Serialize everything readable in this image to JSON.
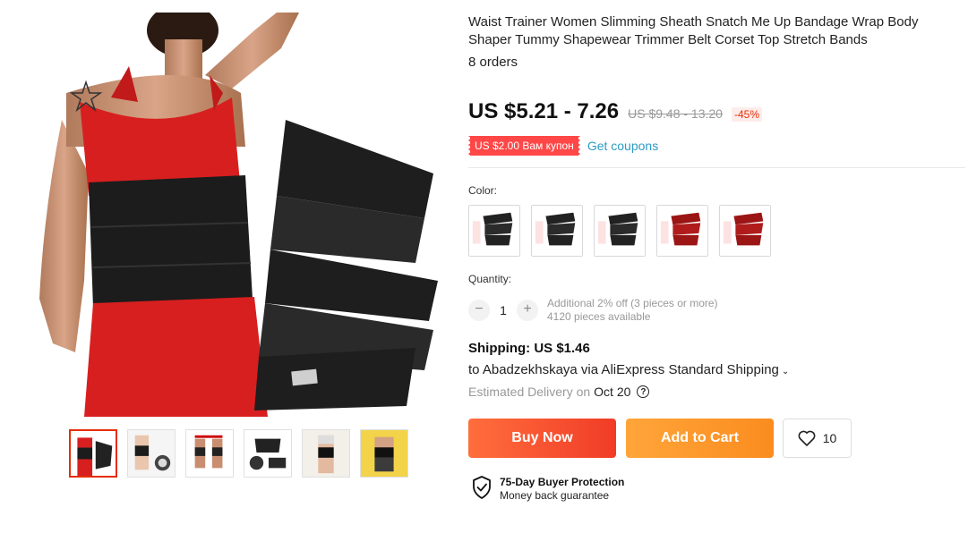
{
  "product": {
    "title": "Waist Trainer Women Slimming Sheath Snatch Me Up Bandage Wrap Body Shaper Tummy Shapewear Trimmer Belt Corset Top Stretch Bands",
    "orders": "8 orders",
    "price": "US $5.21 - 7.26",
    "old_price": "US $9.48 - 13.20",
    "discount": "-45%"
  },
  "coupon": {
    "badge": "US $2.00 Вам купон",
    "link": "Get coupons"
  },
  "colors": {
    "label": "Color:",
    "swatches": [
      "black",
      "black",
      "black",
      "red",
      "red"
    ]
  },
  "quantity": {
    "label": "Quantity:",
    "minus": "−",
    "plus": "+",
    "value": "1",
    "offer": "Additional 2% off (3 pieces or more)",
    "available": "4120 pieces available"
  },
  "shipping": {
    "title": "Shipping: US $1.46",
    "to": "to Abadzekhskaya via AliExpress Standard Shipping",
    "chevron": "⌄",
    "delivery_label": "Estimated Delivery on",
    "delivery_date": "Oct 20",
    "help": "?"
  },
  "actions": {
    "buy_now": "Buy Now",
    "add_to_cart": "Add to Cart",
    "wishlist_count": "10"
  },
  "protection": {
    "title": "75-Day Buyer Protection",
    "subtitle": "Money back guarantee"
  },
  "theme": {
    "accent": "#e62e04",
    "buy_button": "#f13c27",
    "cart_button": "#fb8c1f",
    "coupon_badge": "#ff4747",
    "link": "#2d9bc5"
  },
  "gallery": {
    "thumbnail_count": 6,
    "selected_index": 0
  }
}
